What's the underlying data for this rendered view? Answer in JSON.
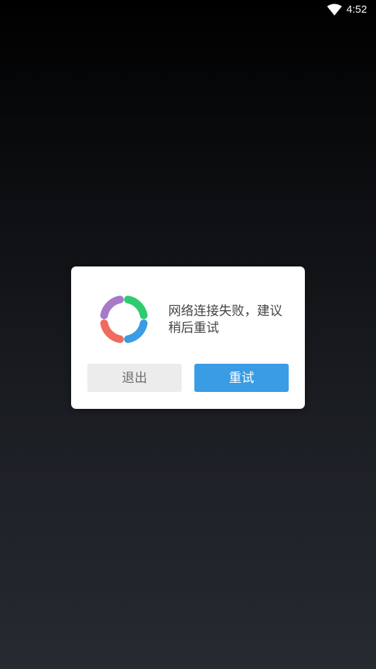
{
  "status_bar": {
    "time": "4:52",
    "wifi_icon": "wifi-icon"
  },
  "dialog": {
    "logo_icon": "app-logo-icon",
    "logo_colors": [
      "#a779c8",
      "#2ecc71",
      "#ef6b5e",
      "#3a9ce3"
    ],
    "message": "网络连接失败，建议稍后重试",
    "exit_label": "退出",
    "retry_label": "重试",
    "retry_color": "#3a9ce3"
  }
}
